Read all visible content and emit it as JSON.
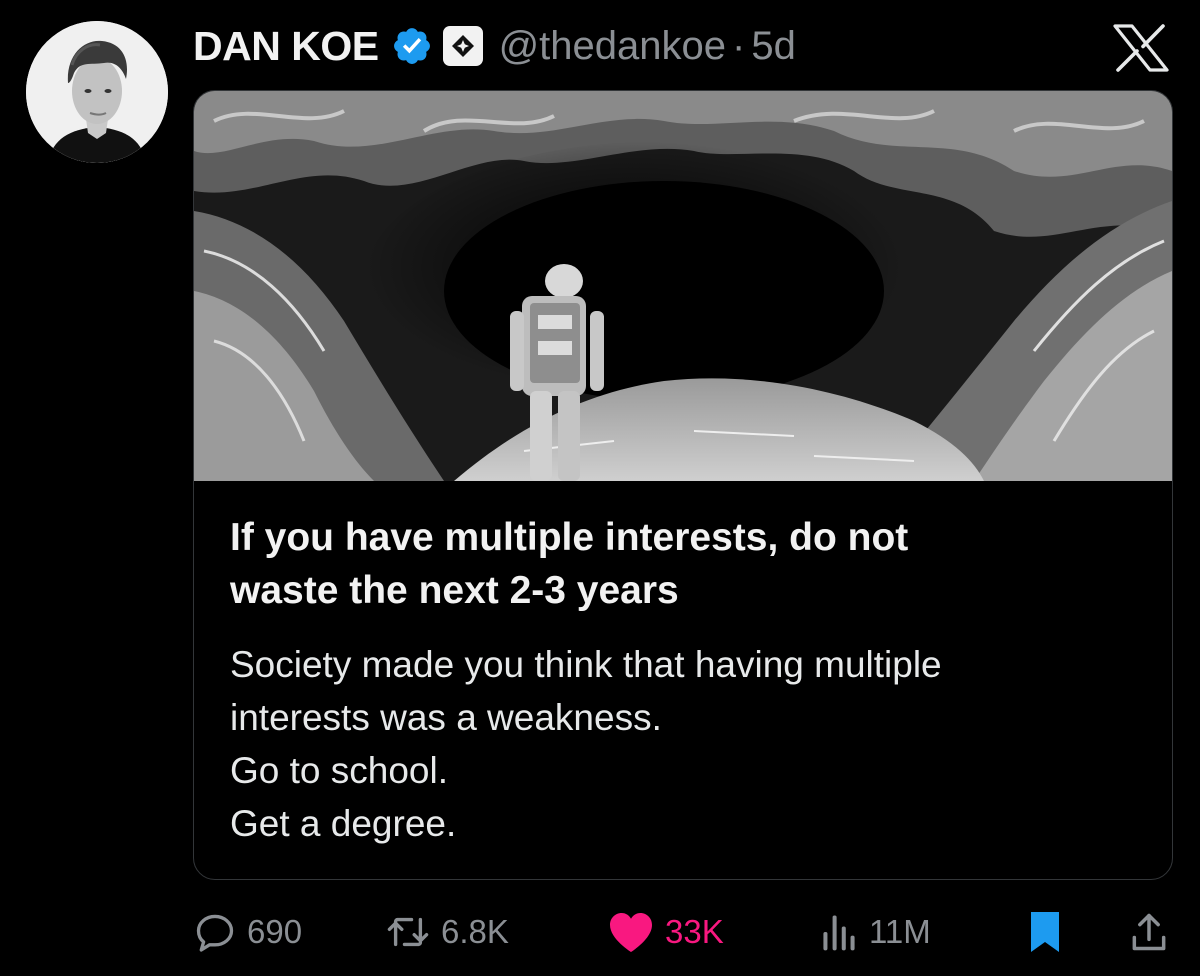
{
  "author": {
    "display_name": "DAN KOE",
    "handle": "@thedankoe",
    "separator": "·",
    "time": "5d",
    "verified_color": "#1d9bf0"
  },
  "card": {
    "title_line1": "If you have multiple interests, do not",
    "title_line2": "waste the next 2-3 years",
    "body": [
      "Society made you think that having multiple",
      "interests was a weakness.",
      "Go to school.",
      "Get a degree."
    ]
  },
  "metrics": {
    "replies": "690",
    "reposts": "6.8K",
    "likes": "33K",
    "views": "11M"
  },
  "colors": {
    "like": "#f91880",
    "bookmark": "#1d9bf0",
    "muted": "#8b8f94"
  },
  "icons": [
    "verified-badge-icon",
    "affiliate-badge-icon",
    "x-logo-icon",
    "reply-icon",
    "repost-icon",
    "heart-icon",
    "views-icon",
    "bookmark-icon",
    "share-icon"
  ]
}
